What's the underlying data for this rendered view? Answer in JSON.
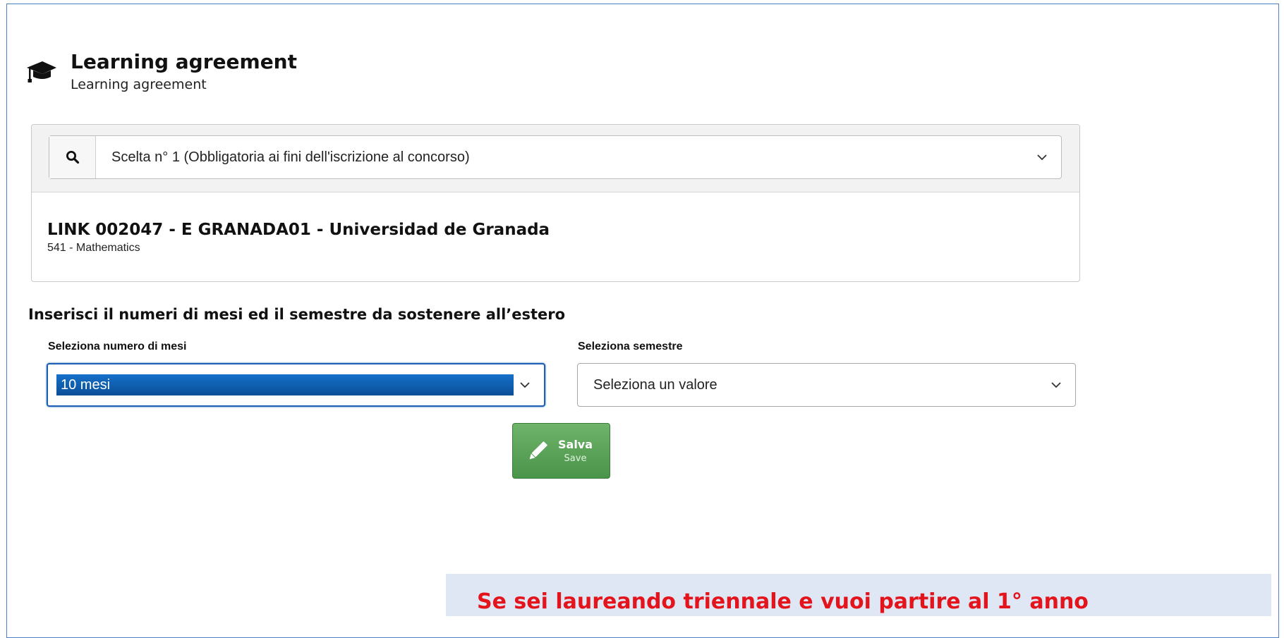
{
  "header": {
    "title": "Learning agreement",
    "subtitle": "Learning agreement",
    "icon": "graduation-cap-icon"
  },
  "choice": {
    "search_icon": "search-icon",
    "selected_label": "Scelta n° 1 (Obbligatoria ai fini dell'iscrizione al concorso)",
    "chevron_icon": "chevron-down-icon"
  },
  "university": {
    "name": "LINK 002047 - E GRANADA01 - Universidad de Granada",
    "subject": "541 - Mathematics"
  },
  "form": {
    "section_title": "Inserisci il numeri di mesi ed il semestre da sostenere all’estero",
    "months": {
      "label": "Seleziona numero di mesi",
      "value": "10 mesi"
    },
    "semester": {
      "label": "Seleziona semestre",
      "value": "Seleziona un valore"
    }
  },
  "save_button": {
    "label": "Salva",
    "sublabel": "Save",
    "icon": "pencil-icon",
    "color": "#5aa557"
  },
  "note": {
    "text": "Se sei laureando triennale e vuoi partire al 1° anno",
    "color": "#e3141b",
    "background": "#dfe7f4"
  },
  "colors": {
    "frame_border": "#4e7fc4",
    "selection_blue": "#0a5aa8"
  }
}
